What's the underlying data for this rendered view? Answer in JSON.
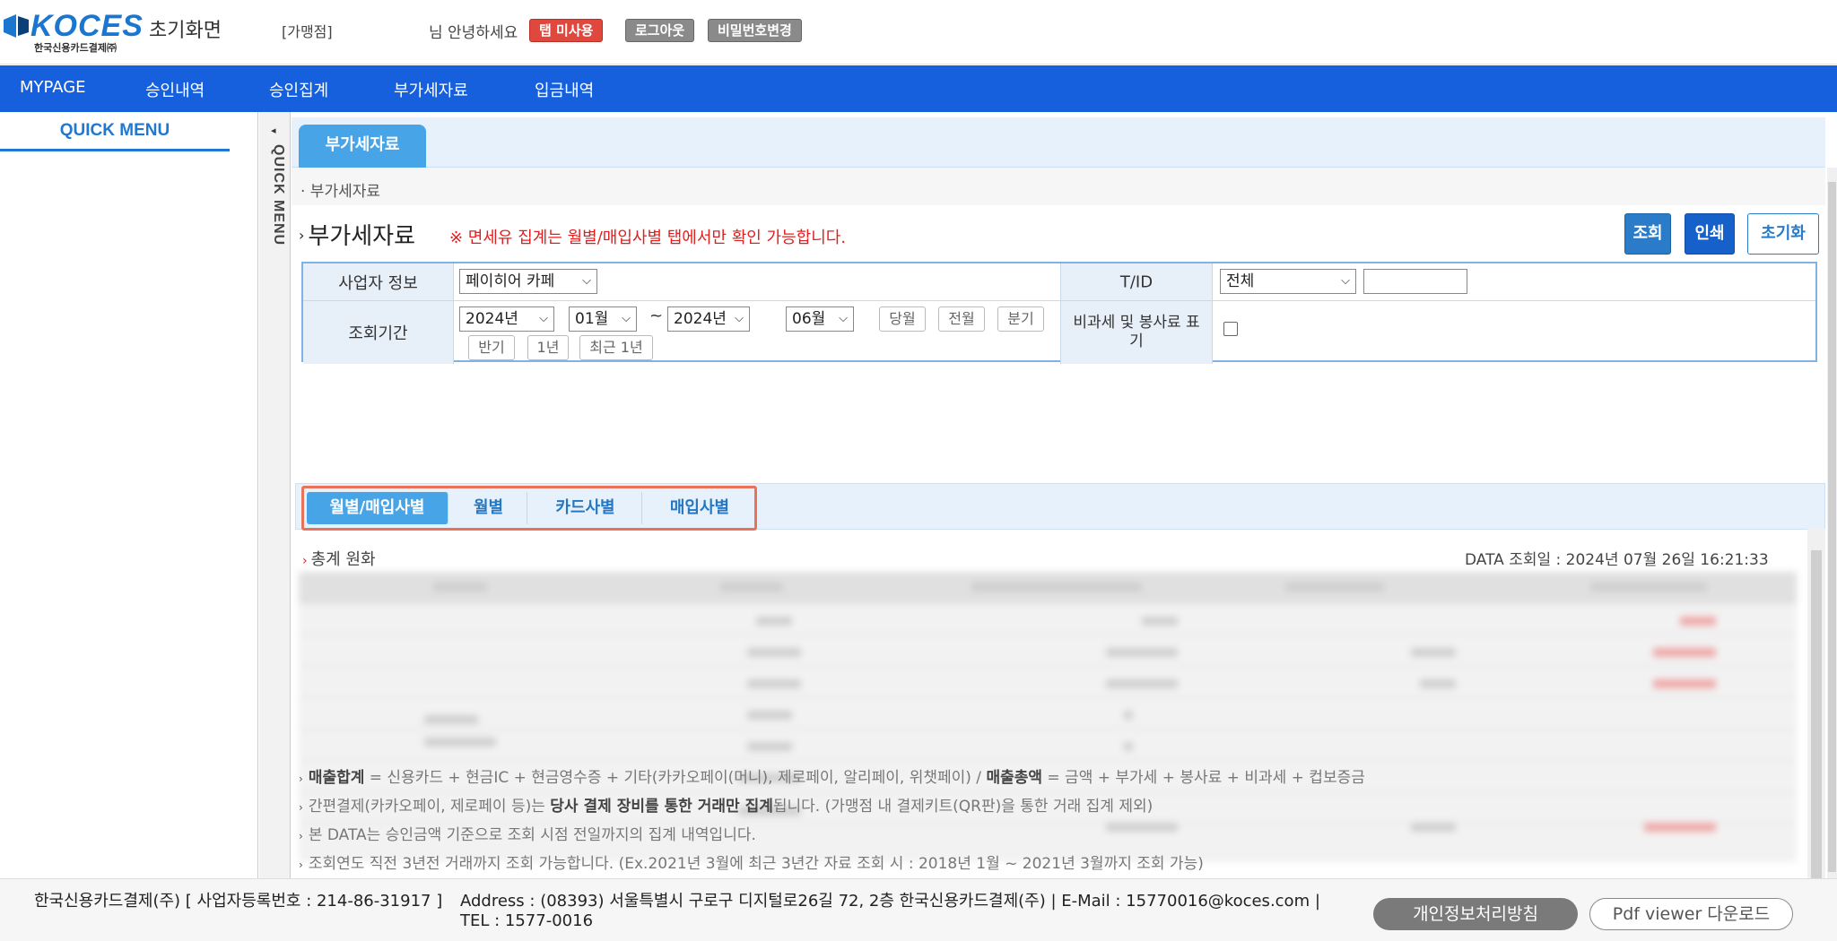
{
  "header": {
    "logo_text": "KOCES",
    "logo_sub": "한국신용카드결제㈜",
    "home_title": "초기화면",
    "merchant": "[가맹점]",
    "greeting": "님 안녕하세요",
    "btn_tap": "탭 미사용",
    "btn_logout": "로그아웃",
    "btn_password": "비밀번호변경"
  },
  "nav": {
    "items": [
      "MYPAGE",
      "승인내역",
      "승인집계",
      "부가세자료",
      "입금내역"
    ]
  },
  "sidebar": {
    "quick_title": "QUICK MENU",
    "quick_tab_text": "QUICK MENU",
    "arrow": "◂"
  },
  "page": {
    "tab": "부가세자료",
    "breadcrumb": "· 부가세자료",
    "section_title": "부가세자료",
    "notice": "※ 면세유 집계는 월별/매입사별 탭에서만 확인 가능합니다.",
    "btn_search": "조회",
    "btn_print": "인쇄",
    "btn_reset": "초기화"
  },
  "filter": {
    "label_business": "사업자 정보",
    "business_value": "페이히어 카페",
    "label_tid": "T/ID",
    "tid_value": "전체",
    "tid_input": "",
    "label_period": "조회기간",
    "start_year": "2024년",
    "start_month": "01월",
    "tilde": "~",
    "end_year": "2024년",
    "end_month": "06월",
    "btn_this_month": "당월",
    "btn_prev_month": "전월",
    "btn_quarter": "분기",
    "btn_half": "반기",
    "btn_1year": "1년",
    "btn_recent_1year": "최근 1년",
    "label_taxfree": "비과세 및 봉사료 표기",
    "taxfree_checked": false
  },
  "result_tabs": [
    "월별/매입사별",
    "월별",
    "카드사별",
    "매입사별"
  ],
  "result": {
    "total_label": "총계 원화",
    "data_date": "DATA 조회일 : 2024년 07월 26일 16:21:33"
  },
  "notes": [
    {
      "bold1": "매출합계",
      "text1": " = 신용카드 + 현금IC + 현금영수증 + 기타(카카오페이(머니), 제로페이, 알리페이, 위챗페이) / ",
      "bold2": "매출총액",
      "text2": " = 금액 + 부가세 + 봉사료 + 비과세 + 컵보증금"
    },
    {
      "text1": "간편결제(카카오페이, 제로페이 등)는 ",
      "bold1": "당사 결제 장비를 통한 거래만 집계",
      "text2": "됩니다. (가맹점 내 결제키트(QR판)을 통한 거래 집계 제외)"
    },
    {
      "text1": "본 DATA는 승인금액 기준으로 조회 시점 전일까지의 집계 내역입니다."
    },
    {
      "text1": "조회연도 직전 3년전 거래까지 조회 가능합니다. (Ex.2021년 3월에 최근 3년간 자료 조회 시 : 2018년 1월 ~ 2021년 3월까지 조회 가능)"
    }
  ],
  "footer": {
    "company": "한국신용카드결제(주) [ 사업자등록번호 : 214-86-31917 ]",
    "address": "Address : (08393) 서울특별시 구로구 디지털로26길 72, 2층 한국신용카드결제(주) | E-Mail : 15770016@koces.com | TEL : 1577-0016",
    "btn_privacy": "개인정보처리방침",
    "btn_pdf": "Pdf viewer 다운로드"
  },
  "colors": {
    "nav_blue": "#1660de",
    "tab_blue": "#47a4e6",
    "notice_red": "#e02020",
    "highlight_orange": "#e8735a"
  }
}
